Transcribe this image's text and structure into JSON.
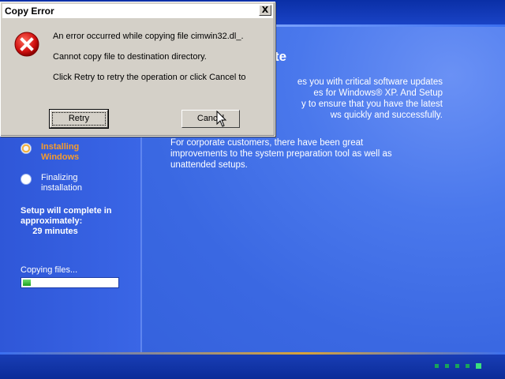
{
  "dialog": {
    "title": "Copy Error",
    "close_glyph": "X",
    "icon": "error-icon",
    "message_1": "An error occurred while copying file cimwin32.dl_.",
    "message_2": "Cannot copy file to destination directory.",
    "message_3": "Click Retry to retry the operation or click Cancel to",
    "retry_label": "Retry",
    "cancel_label": "Cancel"
  },
  "main": {
    "heading": "te",
    "paragraph_1": "es you with critical software updates\nes for Windows® XP. And Setup\ny to ensure that you have the latest\nws quickly and successfully.",
    "paragraph_2": "For corporate customers, there have been great\nimprovements to the system preparation tool as well as\nunattended setups."
  },
  "steps": [
    {
      "label": "Installing\nWindows",
      "state": "active"
    },
    {
      "label": "Finalizing\ninstallation",
      "state": "pending"
    }
  ],
  "eta": {
    "text": "Setup will complete in\napproximately:\n     29 minutes"
  },
  "progress": {
    "label": "Copying files...",
    "fraction": 0.08
  },
  "colors": {
    "active_step": "#f79c2b",
    "background": "#3a6ae0",
    "progress_fill": "#1ea01e"
  }
}
